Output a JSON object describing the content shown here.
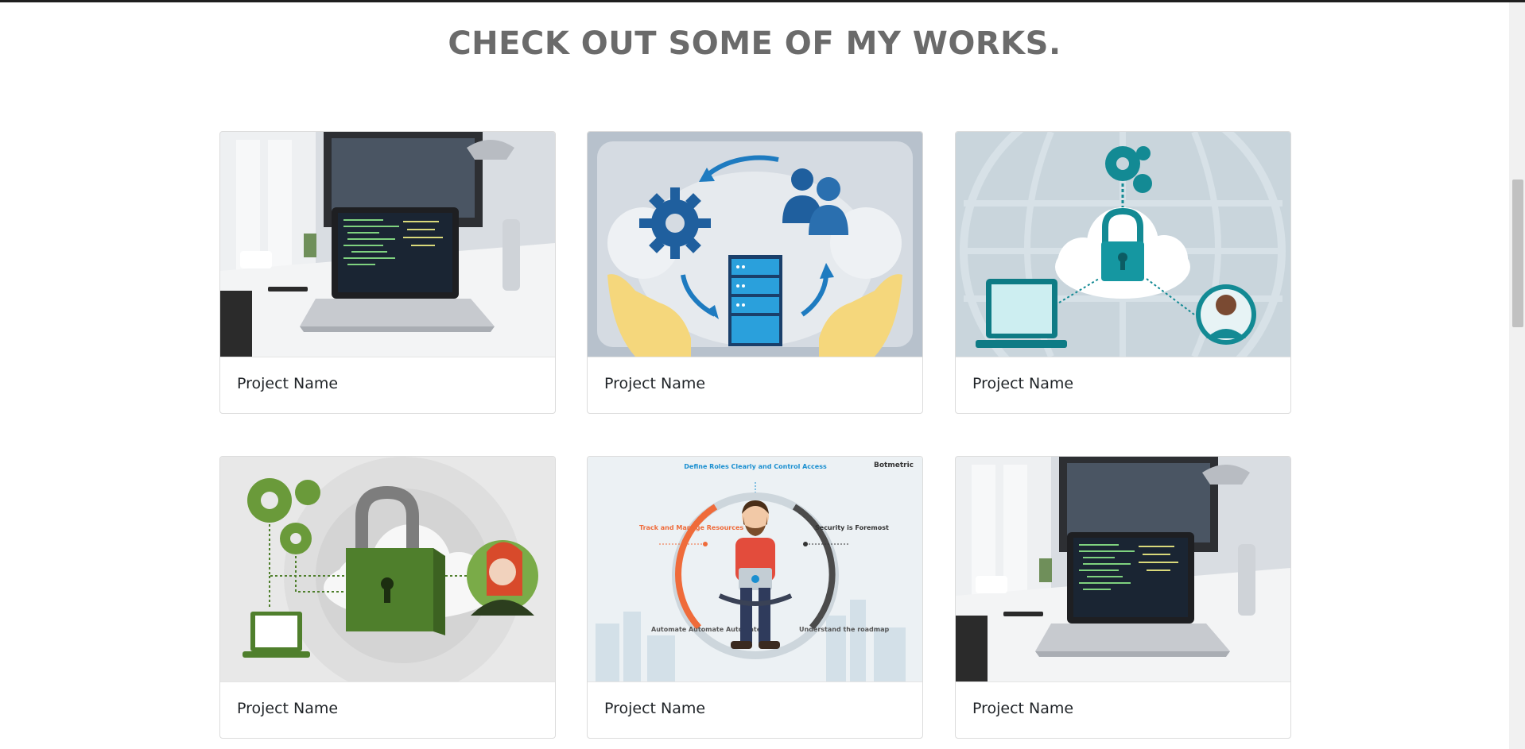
{
  "section": {
    "heading": "CHECK OUT SOME OF MY WORKS."
  },
  "projects": [
    {
      "title": "Project Name",
      "image": "laptop-desk-photo"
    },
    {
      "title": "Project Name",
      "image": "cloud-server-hands-illustration"
    },
    {
      "title": "Project Name",
      "image": "cloud-lock-network-illustration"
    },
    {
      "title": "Project Name",
      "image": "green-lock-gears-illustration"
    },
    {
      "title": "Project Name",
      "image": "developer-cloud-infographic"
    },
    {
      "title": "Project Name",
      "image": "laptop-desk-photo"
    }
  ],
  "infographic": {
    "brand": "Botmetric",
    "top": "Define Roles Clearly and Control Access",
    "left": "Track and Manage Resources",
    "right": "Security is Foremost",
    "bottom_left": "Automate Automate Automate",
    "bottom_right": "Understand the roadmap"
  },
  "colors": {
    "heading": "#6b6b6b",
    "card_border": "#dcdcdc",
    "text": "#212529"
  }
}
